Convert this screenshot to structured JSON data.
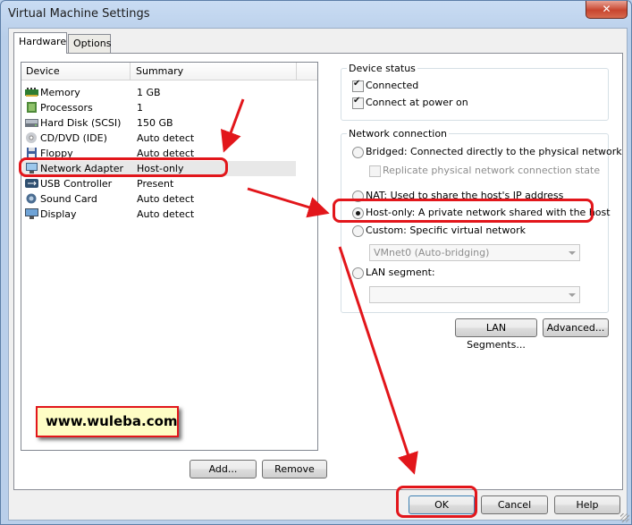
{
  "window": {
    "title": "Virtual Machine Settings",
    "close_glyph": "✕"
  },
  "tabs": [
    {
      "label": "Hardware"
    },
    {
      "label": "Options"
    }
  ],
  "device_list": {
    "headers": {
      "device": "Device",
      "summary": "Summary"
    },
    "rows": [
      {
        "icon": "memory-icon",
        "name": "Memory",
        "summary": "1 GB"
      },
      {
        "icon": "processor-icon",
        "name": "Processors",
        "summary": "1"
      },
      {
        "icon": "hard-disk-icon",
        "name": "Hard Disk (SCSI)",
        "summary": "150 GB"
      },
      {
        "icon": "cd-dvd-icon",
        "name": "CD/DVD (IDE)",
        "summary": "Auto detect"
      },
      {
        "icon": "floppy-icon",
        "name": "Floppy",
        "summary": "Auto detect"
      },
      {
        "icon": "network-adapter-icon",
        "name": "Network Adapter",
        "summary": "Host-only"
      },
      {
        "icon": "usb-icon",
        "name": "USB Controller",
        "summary": "Present"
      },
      {
        "icon": "sound-card-icon",
        "name": "Sound Card",
        "summary": "Auto detect"
      },
      {
        "icon": "display-icon",
        "name": "Display",
        "summary": "Auto detect"
      }
    ],
    "selected": "Network Adapter"
  },
  "device_status": {
    "title": "Device status",
    "connected": {
      "label": "Connected",
      "checked": true
    },
    "connect_at_power_on": {
      "label": "Connect at power on",
      "checked": true
    }
  },
  "network_connection": {
    "title": "Network connection",
    "bridged": {
      "label": "Bridged: Connected directly to the physical network",
      "selected": false
    },
    "replicate": {
      "label": "Replicate physical network connection state",
      "checked": false
    },
    "nat": {
      "label": "NAT: Used to share the host's IP address",
      "selected": false
    },
    "host_only": {
      "label": "Host-only: A private network shared with the host",
      "selected": true
    },
    "custom": {
      "label": "Custom: Specific virtual network",
      "selected": false
    },
    "custom_select": {
      "value": "VMnet0 (Auto-bridging)"
    },
    "lan_segment": {
      "label": "LAN segment:",
      "selected": false
    },
    "lan_select": {
      "value": ""
    }
  },
  "buttons": {
    "lan_segments": "LAN Segments...",
    "advanced": "Advanced...",
    "add": "Add...",
    "remove": "Remove",
    "ok": "OK",
    "cancel": "Cancel",
    "help": "Help"
  },
  "annotation": {
    "banner": "www.wuleba.com",
    "color": "#e2161b"
  }
}
